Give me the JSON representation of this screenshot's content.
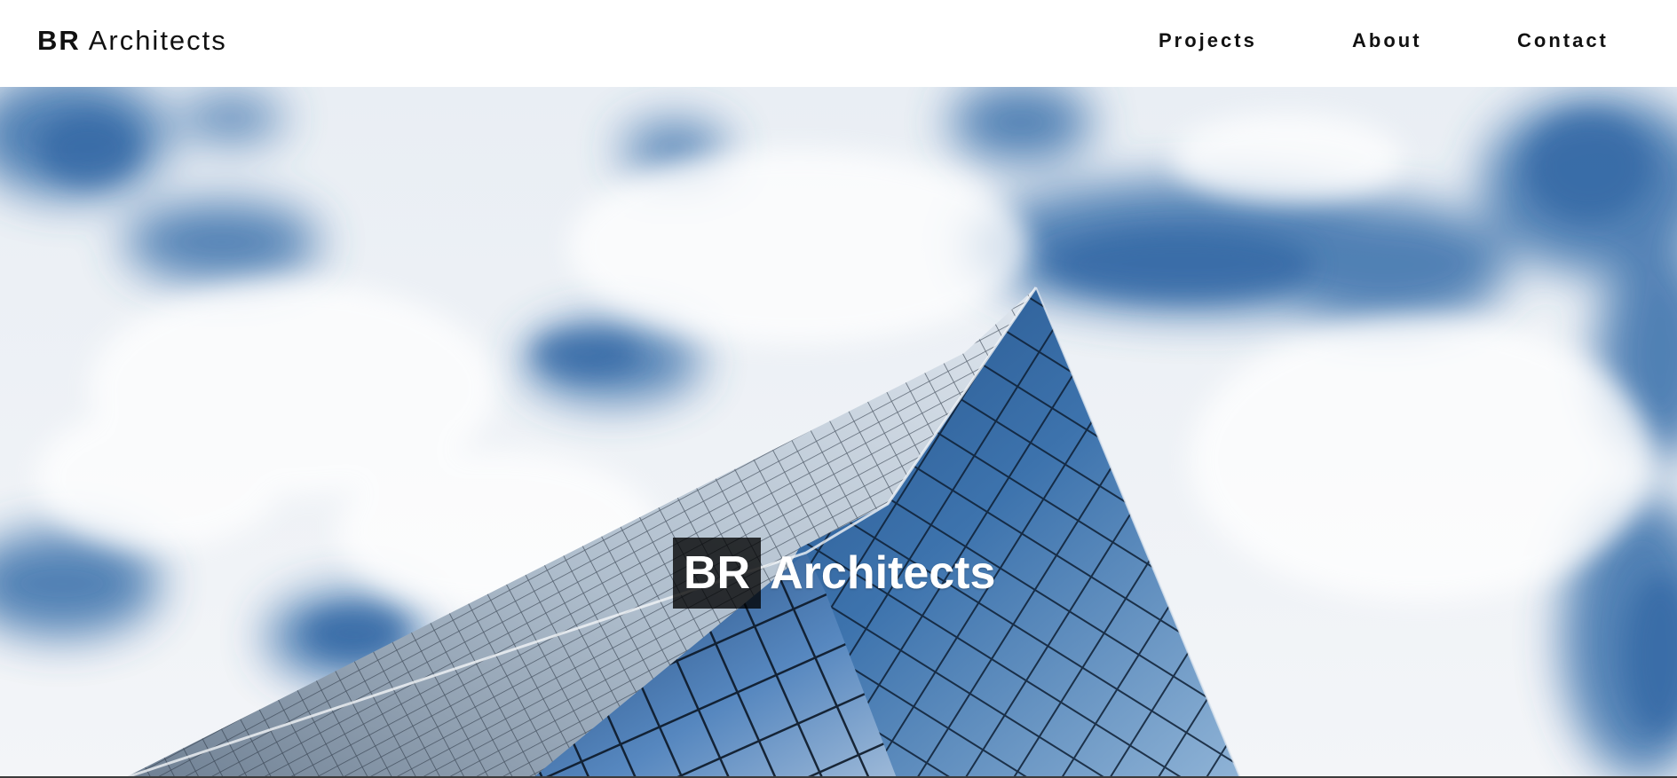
{
  "header": {
    "brand_bold": "BR",
    "brand_rest": "Architects",
    "nav": [
      {
        "label": "Projects"
      },
      {
        "label": "About"
      },
      {
        "label": "Contact"
      }
    ]
  },
  "hero": {
    "title_box": "BR",
    "title_word": "Architects",
    "image": "skyscraper-against-cloudy-sky"
  },
  "colors": {
    "nav_text": "#111111",
    "hero_title_box": "#1a1a1a",
    "sky_blue": "#3f74ad"
  }
}
